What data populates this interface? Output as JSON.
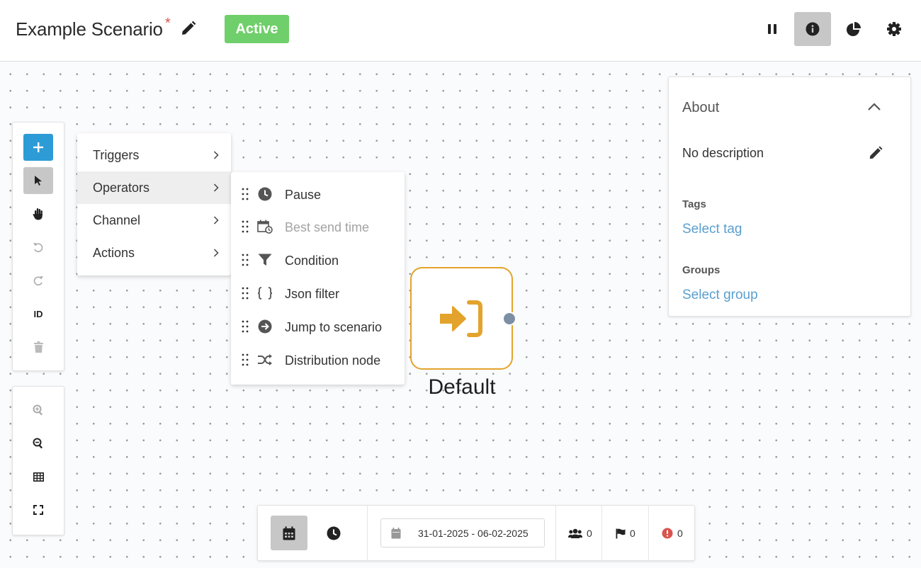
{
  "header": {
    "title": "Example Scenario",
    "unsaved_marker": "*",
    "status": "Active",
    "icons": [
      "pencil-icon",
      "pause-icon",
      "info-icon",
      "pie-chart-icon",
      "gear-icon"
    ]
  },
  "toolbar": {
    "tools": [
      "plus-icon",
      "pointer-icon",
      "hand-icon",
      "undo-icon",
      "redo-icon",
      "id-text",
      "trash-icon"
    ],
    "id_label": "ID",
    "zoom_tools": [
      "zoom-in-icon",
      "zoom-out-icon",
      "grid-icon",
      "fullscreen-icon"
    ]
  },
  "menu": {
    "items": [
      {
        "label": "Triggers"
      },
      {
        "label": "Operators",
        "hover": true
      },
      {
        "label": "Channel"
      },
      {
        "label": "Actions"
      }
    ]
  },
  "submenu": {
    "items": [
      {
        "label": "Pause",
        "icon": "clock-icon"
      },
      {
        "label": "Best send time",
        "icon": "calendar-clock-icon",
        "disabled": true
      },
      {
        "label": "Condition",
        "icon": "filter-icon"
      },
      {
        "label": "Json filter",
        "icon": "braces-icon"
      },
      {
        "label": "Jump to scenario",
        "icon": "arrow-circle-icon"
      },
      {
        "label": "Distribution node",
        "icon": "shuffle-icon"
      }
    ]
  },
  "node": {
    "label": "Default",
    "icon": "sign-in-icon",
    "color": "#e3a32c"
  },
  "about": {
    "title": "About",
    "description": "No description",
    "tags_label": "Tags",
    "tags_link": "Select tag",
    "groups_label": "Groups",
    "groups_link": "Select group"
  },
  "bottom_bar": {
    "date_range": "31-01-2025 - 06-02-2025",
    "users_count": "0",
    "flags_count": "0",
    "errors_count": "0"
  },
  "colors": {
    "status_green": "#6fcf6a",
    "primary_blue": "#2d9bd6",
    "link_blue": "#5a9fcf",
    "node_orange": "#e3a32c",
    "error_red": "#d9534f"
  }
}
